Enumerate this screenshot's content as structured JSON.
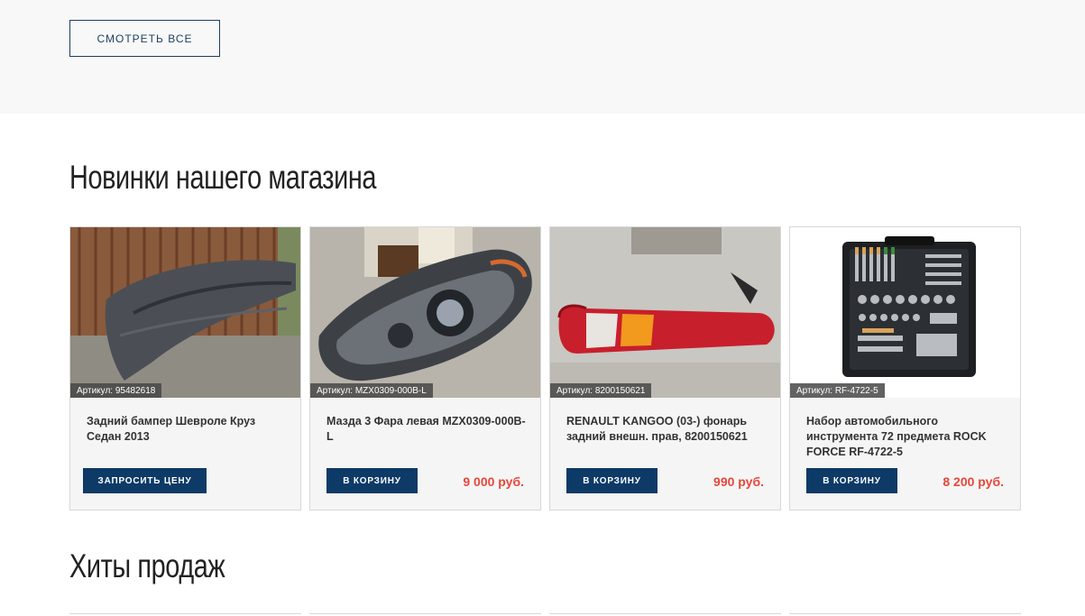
{
  "top": {
    "view_all_label": "СМОТРЕТЬ ВСЕ"
  },
  "sections": {
    "new_title": "Новинки нашего магазина",
    "hits_title": "Хиты продаж"
  },
  "products": [
    {
      "sku": "Артикул: 95482618",
      "name": "Задний бампер Шевроле Круз Седан 2013",
      "button": "ЗАПРОСИТЬ ЦЕНУ",
      "price": ""
    },
    {
      "sku": "Артикул: MZX0309-000B-L",
      "name": "Мазда 3 Фара левая MZX0309-000B-L",
      "button": "В КОРЗИНУ",
      "price": "9 000 руб."
    },
    {
      "sku": "Артикул: 8200150621",
      "name": "RENAULT KANGOO (03-) фонарь задний внешн. прав, 8200150621",
      "button": "В КОРЗИНУ",
      "price": "990 руб."
    },
    {
      "sku": "Артикул: RF-4722-5",
      "name": "Набор автомобильного инструмента 72 предмета ROCK FORCE RF-4722-5",
      "button": "В КОРЗИНУ",
      "price": "8 200 руб."
    }
  ],
  "colors": {
    "accent": "#0d3a66",
    "price": "#e8473a"
  }
}
